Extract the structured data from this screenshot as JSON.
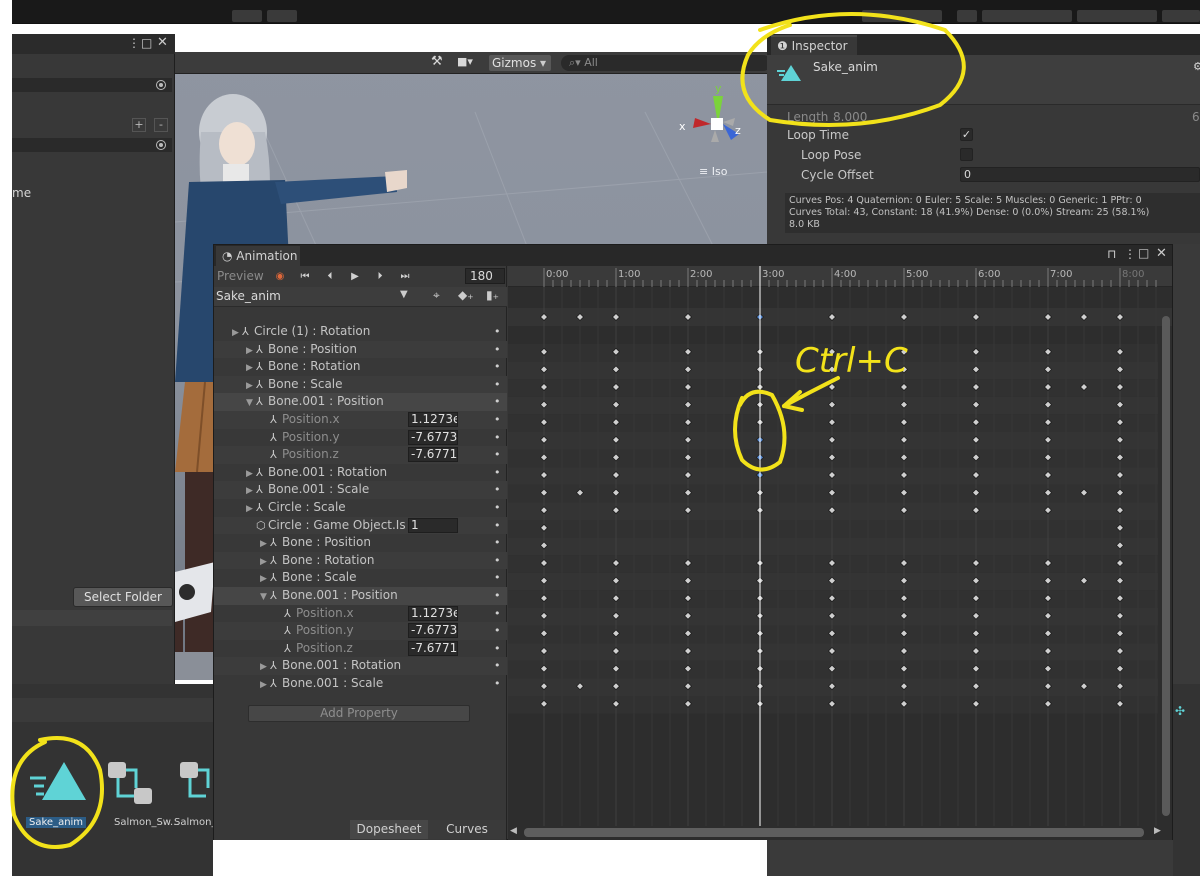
{
  "scene": {
    "gizmos_label": "Gizmos",
    "search_placeholder": "All",
    "projection_label": "Iso",
    "axis_y": "y",
    "axis_x": "x",
    "axis_z": "z"
  },
  "left_panel": {
    "partial_label": "me",
    "select_folder": "Select Folder",
    "plus": "+",
    "minus": "-"
  },
  "inspector": {
    "tab_label": "Inspector",
    "asset_name": "Sake_anim",
    "length_label": "Length",
    "length_value": "8.000",
    "length_right": "6",
    "loop_time_label": "Loop Time",
    "loop_pose_label": "Loop Pose",
    "cycle_offset_label": "Cycle Offset",
    "cycle_offset_value": "0",
    "info_line1": "Curves Pos: 4 Quaternion: 0 Euler: 5 Scale: 5 Muscles: 0 Generic: 1 PPtr: 0",
    "info_line2": "Curves Total: 43, Constant: 18 (41.9%) Dense: 0 (0.0%) Stream: 25 (58.1%)",
    "info_line3": "8.0 KB"
  },
  "animation": {
    "tab_label": "Animation",
    "preview_label": "Preview",
    "frame": "180",
    "clip_name": "Sake_anim",
    "add_property": "Add Property",
    "dopesheet_tab": "Dopesheet",
    "curves_tab": "Curves",
    "ruler_labels": [
      "0:00",
      "1:00",
      "2:00",
      "3:00",
      "4:00",
      "5:00",
      "6:00",
      "7:00",
      "8:00"
    ],
    "properties": [
      {
        "label": "Circle (1) : Rotation",
        "indent": 0,
        "expand": "right",
        "icon": "bone",
        "value": ""
      },
      {
        "label": "Bone : Position",
        "indent": 1,
        "expand": "right",
        "icon": "bone",
        "value": ""
      },
      {
        "label": "Bone : Rotation",
        "indent": 1,
        "expand": "right",
        "icon": "bone",
        "value": ""
      },
      {
        "label": "Bone : Scale",
        "indent": 1,
        "expand": "right",
        "icon": "bone",
        "value": ""
      },
      {
        "label": "Bone.001 : Position",
        "indent": 1,
        "expand": "down",
        "icon": "bone",
        "value": ""
      },
      {
        "label": "Position.x",
        "indent": 2,
        "expand": "",
        "icon": "bone",
        "value": "1.1273e"
      },
      {
        "label": "Position.y",
        "indent": 2,
        "expand": "",
        "icon": "bone",
        "value": "-7.6773"
      },
      {
        "label": "Position.z",
        "indent": 2,
        "expand": "",
        "icon": "bone",
        "value": "-7.6771"
      },
      {
        "label": "Bone.001 : Rotation",
        "indent": 1,
        "expand": "right",
        "icon": "bone",
        "value": ""
      },
      {
        "label": "Bone.001 : Scale",
        "indent": 1,
        "expand": "right",
        "icon": "bone",
        "value": ""
      },
      {
        "label": "Circle : Scale",
        "indent": 1,
        "expand": "right",
        "icon": "bone",
        "value": ""
      },
      {
        "label": "Circle : Game Object.Is",
        "indent": 1,
        "expand": "",
        "icon": "cube",
        "value": "1"
      },
      {
        "label": "Bone : Position",
        "indent": 2,
        "expand": "right",
        "icon": "bone",
        "value": ""
      },
      {
        "label": "Bone : Rotation",
        "indent": 2,
        "expand": "right",
        "icon": "bone",
        "value": ""
      },
      {
        "label": "Bone : Scale",
        "indent": 2,
        "expand": "right",
        "icon": "bone",
        "value": ""
      },
      {
        "label": "Bone.001 : Position",
        "indent": 2,
        "expand": "down",
        "icon": "bone",
        "value": ""
      },
      {
        "label": "Position.x",
        "indent": 3,
        "expand": "",
        "icon": "bone",
        "value": "1.1273e"
      },
      {
        "label": "Position.y",
        "indent": 3,
        "expand": "",
        "icon": "bone",
        "value": "-7.6773"
      },
      {
        "label": "Position.z",
        "indent": 3,
        "expand": "",
        "icon": "bone",
        "value": "-7.6771"
      },
      {
        "label": "Bone.001 : Rotation",
        "indent": 2,
        "expand": "right",
        "icon": "bone",
        "value": ""
      },
      {
        "label": "Bone.001 : Scale",
        "indent": 2,
        "expand": "right",
        "icon": "bone",
        "value": ""
      }
    ],
    "keyframes_summary": [
      0,
      0.5,
      1,
      2,
      3,
      4,
      5,
      6,
      7,
      7.5,
      8
    ],
    "keyframes_rows": [
      [
        0,
        1,
        2,
        3,
        4,
        5,
        6,
        7,
        8
      ],
      [
        0,
        1,
        2,
        3,
        4,
        5,
        6,
        7,
        8
      ],
      [
        0,
        1,
        2,
        3,
        4,
        5,
        6,
        7,
        7.5,
        8
      ],
      [
        0,
        1,
        2,
        3,
        4,
        5,
        6,
        7,
        8
      ],
      [
        0,
        1,
        2,
        3,
        4,
        5,
        6,
        7,
        8
      ],
      [
        0,
        1,
        2,
        3,
        4,
        5,
        6,
        7,
        8
      ],
      [
        0,
        1,
        2,
        3,
        4,
        5,
        6,
        7,
        8
      ],
      [
        0,
        1,
        2,
        3,
        4,
        5,
        6,
        7,
        8
      ],
      [
        0,
        0.5,
        1,
        2,
        3,
        4,
        5,
        6,
        7,
        7.5,
        8
      ],
      [
        0,
        1,
        2,
        3,
        4,
        5,
        6,
        7,
        8
      ],
      [
        0,
        8
      ],
      [
        0,
        8
      ],
      [
        0,
        1,
        2,
        3,
        4,
        5,
        6,
        7,
        8
      ],
      [
        0,
        1,
        2,
        3,
        4,
        5,
        6,
        7,
        7.5,
        8
      ],
      [
        0,
        1,
        2,
        3,
        4,
        5,
        6,
        7,
        8
      ],
      [
        0,
        1,
        2,
        3,
        4,
        5,
        6,
        7,
        8
      ],
      [
        0,
        1,
        2,
        3,
        4,
        5,
        6,
        7,
        8
      ],
      [
        0,
        1,
        2,
        3,
        4,
        5,
        6,
        7,
        8
      ],
      [
        0,
        1,
        2,
        3,
        4,
        5,
        6,
        7,
        8
      ],
      [
        0,
        0.5,
        1,
        2,
        3,
        4,
        5,
        6,
        7,
        7.5,
        8
      ],
      [
        0,
        1,
        2,
        3,
        4,
        5,
        6,
        7,
        8
      ]
    ],
    "selected_time": 3,
    "selected_rows": [
      4,
      5,
      6,
      7
    ]
  },
  "annotation": {
    "handwritten_text": "Ctrl+C"
  },
  "project": {
    "assets": [
      {
        "name": "Sake_anim",
        "selected": true
      },
      {
        "name": "Salmon_Sw...",
        "selected": false
      },
      {
        "name": "Salmon_",
        "selected": false
      }
    ]
  },
  "colors": {
    "accent_teal": "#5fd3d6",
    "highlight_yellow": "#f2e21a",
    "keyframe_selected": "#5b8fd8",
    "keyframe": "#cfcfcf",
    "selection_blue": "#2c5d87"
  }
}
